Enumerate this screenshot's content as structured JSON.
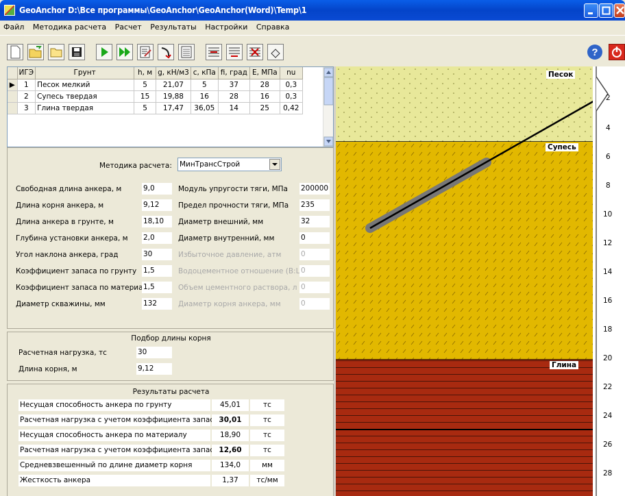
{
  "window": {
    "title": "GeoAnchor D:\\Все программы\\GeoAnchor\\GeoAnchor(Word)\\Temp\\1"
  },
  "menu": [
    "Файл",
    "Методика расчета",
    "Расчет",
    "Результаты",
    "Настройки",
    "Справка"
  ],
  "toolbar_icons": [
    "new-file-icon",
    "open-folder-icon",
    "folder-icon",
    "save-icon",
    "run-icon",
    "run-all-icon",
    "edit-report-icon",
    "curve-icon",
    "document-icon",
    "insert-row-icon",
    "add-row-icon",
    "delete-row-icon",
    "eraser-icon",
    "help-icon",
    "exit-icon"
  ],
  "soil_table": {
    "headers": [
      "ИГЭ",
      "Грунт",
      "h, м",
      "g, кН/м3",
      "c, кПа",
      "fi, град",
      "E, МПа",
      "nu"
    ],
    "rows": [
      [
        "1",
        "Песок мелкий",
        "5",
        "21,07",
        "5",
        "37",
        "28",
        "0,3"
      ],
      [
        "2",
        "Супесь твердая",
        "15",
        "19,88",
        "16",
        "28",
        "16",
        "0,3"
      ],
      [
        "3",
        "Глина твердая",
        "5",
        "17,47",
        "36,05",
        "14",
        "25",
        "0,42"
      ]
    ]
  },
  "method": {
    "label": "Методика расчета:",
    "value": "МинТрансСтрой"
  },
  "params_left": [
    {
      "label": "Свободная длина анкера, м",
      "value": "9,0"
    },
    {
      "label": "Длина корня анкера, м",
      "value": "9,12"
    },
    {
      "label": "Длина анкера в грунте, м",
      "value": "18,10"
    },
    {
      "label": "Глубина установки анкера, м",
      "value": "2,0"
    },
    {
      "label": "Угол наклона анкера, град",
      "value": "30"
    },
    {
      "label": "Коэффициент запаса по грунту",
      "value": "1,5"
    },
    {
      "label": "Коэффициент запаса по материалу",
      "value": "1,5"
    },
    {
      "label": "Диаметр скважины, мм",
      "value": "132"
    }
  ],
  "params_right": [
    {
      "label": "Модуль упругости тяги, МПа",
      "value": "200000"
    },
    {
      "label": "Предел прочности тяги, МПа",
      "value": "235"
    },
    {
      "label": "Диаметр внешний, мм",
      "value": "32"
    },
    {
      "label": "Диаметр внутренний, мм",
      "value": "0"
    },
    {
      "label": "Избыточное давление, атм",
      "value": "0"
    },
    {
      "label": "Водоцементное отношение (В:Ц)",
      "value": "0"
    },
    {
      "label": "Объем цементного раствора, л",
      "value": "0"
    },
    {
      "label": "Диаметр корня анкера, мм",
      "value": "0"
    }
  ],
  "root_selection": {
    "title": "Подбор длины корня",
    "rows": [
      {
        "label": "Расчетная нагрузка, тс",
        "value": "30"
      },
      {
        "label": "Длина корня, м",
        "value": "9,12"
      }
    ]
  },
  "results": {
    "title": "Результаты расчета",
    "rows": [
      {
        "label": "Несущая  способность анкера по грунту",
        "value": "45,01",
        "unit": "тс",
        "bold": false
      },
      {
        "label": "Расчетная нагрузка с учетом коэффициента запаса",
        "value": "30,01",
        "unit": "тс",
        "bold": true
      },
      {
        "label": "Несущая  способность анкера по материалу",
        "value": "18,90",
        "unit": "тс",
        "bold": false
      },
      {
        "label": "Расчетная нагрузка с учетом коэффициента запаса",
        "value": "12,60",
        "unit": "тс",
        "bold": true
      },
      {
        "label": "Средневзвешенный по длине  диаметр корня",
        "value": "134,0",
        "unit": "мм",
        "bold": false
      },
      {
        "label": "Жесткость анкера",
        "value": "1,37",
        "unit": "тс/мм",
        "bold": false
      }
    ]
  },
  "section": {
    "layers": [
      {
        "name": "Песок",
        "thickness": 5,
        "color": "#e8e89a"
      },
      {
        "name": "Супесь",
        "thickness": 15,
        "color": "#e2b800"
      },
      {
        "name": "Глина",
        "thickness": 5,
        "color": "#a82a10"
      }
    ],
    "depth_ticks": [
      "2",
      "4",
      "6",
      "8",
      "10",
      "12",
      "14",
      "16",
      "18",
      "20",
      "22",
      "24",
      "26",
      "28"
    ]
  }
}
